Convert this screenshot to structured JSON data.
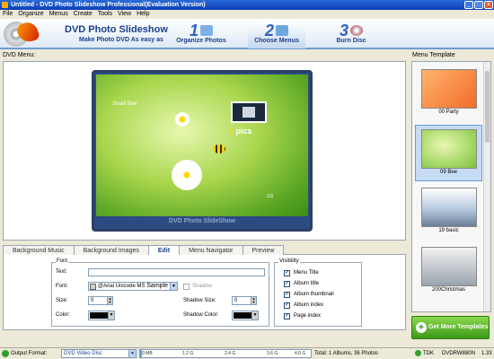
{
  "window": {
    "title": "Untitled - DVD Photo Slideshow Professional(Evaluation Version)"
  },
  "menubar": [
    "File",
    "Organize",
    "Menus",
    "Create",
    "Tools",
    "View",
    "Help"
  ],
  "banner": {
    "brand": "DVD Photo Slideshow",
    "tagline": "Make Photo DVD As easy as",
    "steps": [
      {
        "num": "1",
        "label": "Organize Photos"
      },
      {
        "num": "2",
        "label": "Choose Menus"
      },
      {
        "num": "3",
        "label": "Burn Disc"
      }
    ]
  },
  "main": {
    "dvd_menu_label": "DVD Menu:",
    "dvd_title": "Small Bee",
    "dvd_index_num": "1",
    "dvd_index_text": "pics",
    "dvd_page": "1/3",
    "dvd_caption": "DVD Photo SlideShow"
  },
  "tabs": [
    "Background Music",
    "Background Images",
    "Edit",
    "Menu Navigator",
    "Preview"
  ],
  "edit": {
    "font_group": "Font",
    "text_label": "Text:",
    "text_value": "",
    "font_label": "Font:",
    "font_value": "@Arial Unicode MS",
    "font_sample": "Sample",
    "shadow_label": "Shadow",
    "size_label": "Size:",
    "size_value": "0",
    "shadow_size_label": "Shadow Size:",
    "shadow_size_value": "0",
    "color_label": "Color:",
    "shadow_color_label": "Shadow Color:",
    "visibility_group": "Visibility",
    "visibility": [
      "Menu Title",
      "Album title",
      "Album thumbnail",
      "Album index",
      "Page index"
    ]
  },
  "templates": {
    "label": "Menu Template",
    "items": [
      "00 Party",
      "09 Bee",
      "19 basic",
      "200Christmas"
    ],
    "more_button": "Get More Templates ..."
  },
  "status": {
    "output_label": "Output Format:",
    "output_value": "DVD Video Disc",
    "capacity_ticks": [
      "0 MB",
      "1.2 G",
      "2.4 G",
      "3.6 G",
      "4.8 G"
    ],
    "used_fraction": 0.01,
    "summary": "Total: 1 Albums, 36 Photos",
    "drive": "TDK",
    "drive_model": "DVDRW880N",
    "drive_ver": "1.33"
  },
  "colors": {
    "accent": "#1a3f8a",
    "titlebar": "#0b3fb5",
    "more_button": "#3b9a18"
  }
}
